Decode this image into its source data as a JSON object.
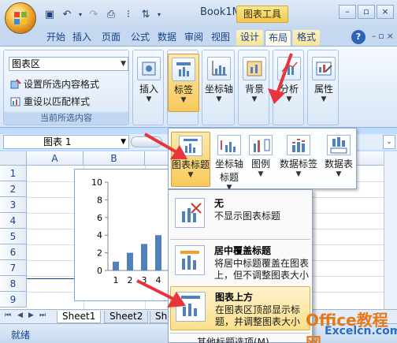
{
  "title_bar": {
    "document": "Book1M",
    "tool_context": "图表工具",
    "window_buttons": [
      "–",
      "▫",
      "×"
    ]
  },
  "tabs": [
    {
      "label": "开始"
    },
    {
      "label": "插入"
    },
    {
      "label": "页面"
    },
    {
      "label": "公式"
    },
    {
      "label": "数据"
    },
    {
      "label": "审阅"
    },
    {
      "label": "视图"
    },
    {
      "label": "设计"
    },
    {
      "label": "布局"
    },
    {
      "label": "格式"
    }
  ],
  "help_label": "?",
  "ribbon": {
    "current_selection": {
      "combo_value": "图表区",
      "format_selection": "设置所选内容格式",
      "reset_style": "重设以匹配样式",
      "group_label": "当前所选内容"
    },
    "buttons": [
      {
        "label": "插入"
      },
      {
        "label": "标签"
      },
      {
        "label": "坐标轴"
      },
      {
        "label": "背景"
      },
      {
        "label": "分析"
      },
      {
        "label": "属性"
      }
    ]
  },
  "formula_bar": {
    "name_box": "图表 1"
  },
  "columns": [
    "A",
    "B"
  ],
  "rows": [
    "1",
    "2",
    "3",
    "4",
    "5",
    "6",
    "7",
    "8",
    "9"
  ],
  "label_gallery": [
    {
      "label": "图表标题"
    },
    {
      "label": "坐标轴标题"
    },
    {
      "label": "图例"
    },
    {
      "label": "数据标签"
    },
    {
      "label": "数据表"
    }
  ],
  "title_menu": {
    "items": [
      {
        "title": "无",
        "desc": "不显示图表标题"
      },
      {
        "title": "居中覆盖标题",
        "desc": "将居中标题覆盖在图表上，但不调整图表大小"
      },
      {
        "title": "图表上方",
        "desc": "在图表区顶部显示标题，并调整图表大小"
      }
    ],
    "more": "其他标题选项(M)..."
  },
  "sheet_tabs": [
    "Sheet1",
    "Sheet2",
    "She"
  ],
  "status": "就绪",
  "watermark": {
    "line1": "Office教程网",
    "line2": "Excelcn.com"
  },
  "chart_data": {
    "type": "bar",
    "categories": [
      "1",
      "2",
      "3",
      "4"
    ],
    "values": [
      1,
      2,
      3,
      4
    ],
    "ylim": [
      0,
      10
    ],
    "yticks": [
      "0",
      "2",
      "4",
      "6",
      "8",
      "10"
    ],
    "color": "#4f81bd"
  },
  "colors": {
    "accent": "#f7c95a",
    "arrow": "#e8343a",
    "bar": "#4f81bd"
  }
}
